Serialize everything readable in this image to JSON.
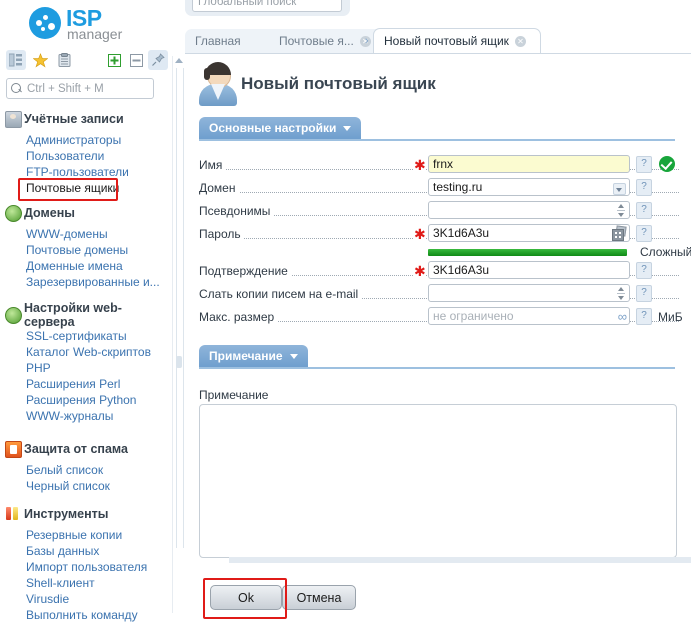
{
  "brand": {
    "name_bold": "ISP",
    "name_light": "manager"
  },
  "sidebar": {
    "toolbar": [
      {
        "name": "tree-icon",
        "glyph": "☰"
      },
      {
        "name": "star-icon",
        "glyph": "★"
      },
      {
        "name": "clipboard-icon",
        "glyph": "📋"
      },
      {
        "name": "expand-all-icon",
        "glyph": "⊞"
      },
      {
        "name": "collapse-all-icon",
        "glyph": "⊟"
      },
      {
        "name": "pin-icon",
        "glyph": "📌"
      }
    ],
    "search": {
      "placeholder": "Ctrl + Shift + M"
    },
    "groups": [
      {
        "title": "Учётные записи",
        "icon": "user-icon",
        "items": [
          {
            "label": "Администраторы",
            "selected": false
          },
          {
            "label": "Пользователи",
            "selected": false
          },
          {
            "label": "FTP-пользователи",
            "selected": false
          },
          {
            "label": "Почтовые ящики",
            "selected": true
          }
        ]
      },
      {
        "title": "Домены",
        "icon": "globe-icon",
        "items": [
          {
            "label": "WWW-домены",
            "selected": false
          },
          {
            "label": "Почтовые домены",
            "selected": false
          },
          {
            "label": "Доменные имена",
            "selected": false
          },
          {
            "label": "Зарезервированные и...",
            "selected": false
          }
        ]
      },
      {
        "title": "Настройки web-сервера",
        "icon": "globe-settings-icon",
        "items": [
          {
            "label": "SSL-сертификаты",
            "selected": false
          },
          {
            "label": "Каталог Web-скриптов",
            "selected": false
          },
          {
            "label": "PHP",
            "selected": false
          },
          {
            "label": "Расширения Perl",
            "selected": false
          },
          {
            "label": "Расширения Python",
            "selected": false
          },
          {
            "label": "WWW-журналы",
            "selected": false
          }
        ]
      },
      {
        "title": "Защита от спама",
        "icon": "shield-icon",
        "items": [
          {
            "label": "Белый список",
            "selected": false
          },
          {
            "label": "Черный список",
            "selected": false
          }
        ]
      },
      {
        "title": "Инструменты",
        "icon": "tools-icon",
        "items": [
          {
            "label": "Резервные копии",
            "selected": false
          },
          {
            "label": "Базы данных",
            "selected": false
          },
          {
            "label": "Импорт пользователя",
            "selected": false
          },
          {
            "label": "Shell-клиент",
            "selected": false
          },
          {
            "label": "Virusdie",
            "selected": false
          },
          {
            "label": "Выполнить команду",
            "selected": false
          }
        ]
      }
    ]
  },
  "global_search": {
    "placeholder": "Глобальный поиск"
  },
  "tabs": [
    {
      "label": "Главная",
      "active": false,
      "closable": false
    },
    {
      "label": "Почтовые я...",
      "active": false,
      "closable": true
    },
    {
      "label": "Новый почтовый ящик",
      "active": true,
      "closable": true
    }
  ],
  "form": {
    "title": "Новый почтовый ящик",
    "section_main": "Основные настройки",
    "section_note": "Примечание",
    "help_glyph": "?",
    "fields": [
      {
        "label": "Имя",
        "value": "frnx",
        "placeholder": "",
        "required": true,
        "kind": "text-yellow",
        "valid": true
      },
      {
        "label": "Домен",
        "value": "testing.ru",
        "placeholder": "",
        "required": false,
        "kind": "select",
        "valid": false
      },
      {
        "label": "Псевдонимы",
        "value": "",
        "placeholder": "",
        "required": false,
        "kind": "spinner",
        "valid": false
      },
      {
        "label": "Пароль",
        "value": "3K1d6A3u",
        "placeholder": "",
        "required": true,
        "kind": "password",
        "valid": false
      },
      {
        "label": "Подтверждение",
        "value": "3K1d6A3u",
        "placeholder": "",
        "required": true,
        "kind": "text",
        "valid": false
      },
      {
        "label": "Слать копии писем на e-mail",
        "value": "",
        "placeholder": "",
        "required": false,
        "kind": "spinner",
        "valid": false
      },
      {
        "label": "Макс. размер",
        "value": "",
        "placeholder": "не ограничено",
        "required": false,
        "kind": "infinity",
        "valid": false
      }
    ],
    "password_strength": {
      "text": "Сложный",
      "percent": 78
    },
    "max_size_unit": "МиБ",
    "note_label": "Примечание",
    "note_value": ""
  },
  "buttons": {
    "ok": "Ok",
    "cancel": "Отмена"
  },
  "colors": {
    "accent": "#1e9ce0",
    "link": "#3b73af",
    "required": "#e01b18",
    "highlight": "#e01b18",
    "valid": "#18a53b",
    "strength": "#18a53b"
  }
}
